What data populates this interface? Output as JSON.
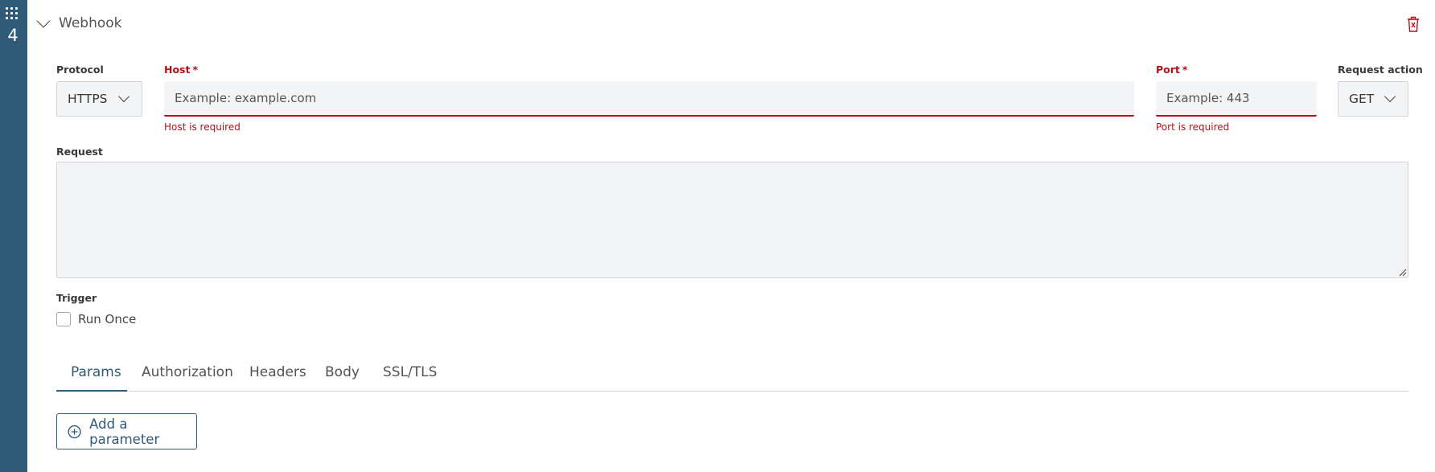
{
  "step": {
    "number": "4"
  },
  "section": {
    "title": "Webhook"
  },
  "protocol": {
    "label": "Protocol",
    "value": "HTTPS"
  },
  "host": {
    "label": "Host",
    "required_mark": "*",
    "placeholder": "Example: example.com",
    "value": "",
    "error": "Host is required"
  },
  "port": {
    "label": "Port",
    "required_mark": "*",
    "placeholder": "Example: 443",
    "value": "",
    "error": "Port is required"
  },
  "request_action": {
    "label": "Request action",
    "value": "GET"
  },
  "request": {
    "label": "Request",
    "value": ""
  },
  "trigger": {
    "label": "Trigger",
    "run_once_label": "Run Once",
    "run_once_checked": false
  },
  "tabs": [
    {
      "label": "Params",
      "active": true
    },
    {
      "label": "Authorization",
      "active": false
    },
    {
      "label": "Headers",
      "active": false
    },
    {
      "label": "Body",
      "active": false
    },
    {
      "label": "SSL/TLS",
      "active": false
    }
  ],
  "params": {
    "add_button_label": "Add a parameter"
  },
  "colors": {
    "rail": "#2f5a78",
    "error": "#b3121a",
    "accent": "#2f5a78",
    "field_bg": "#f3f4f6"
  },
  "icons": {
    "drag": "drag-grid-icon",
    "collapse": "chevron-down-icon",
    "delete": "trash-icon",
    "add": "plus-circle-icon",
    "select": "chevron-down-icon",
    "resize": "resize-grip-icon"
  }
}
